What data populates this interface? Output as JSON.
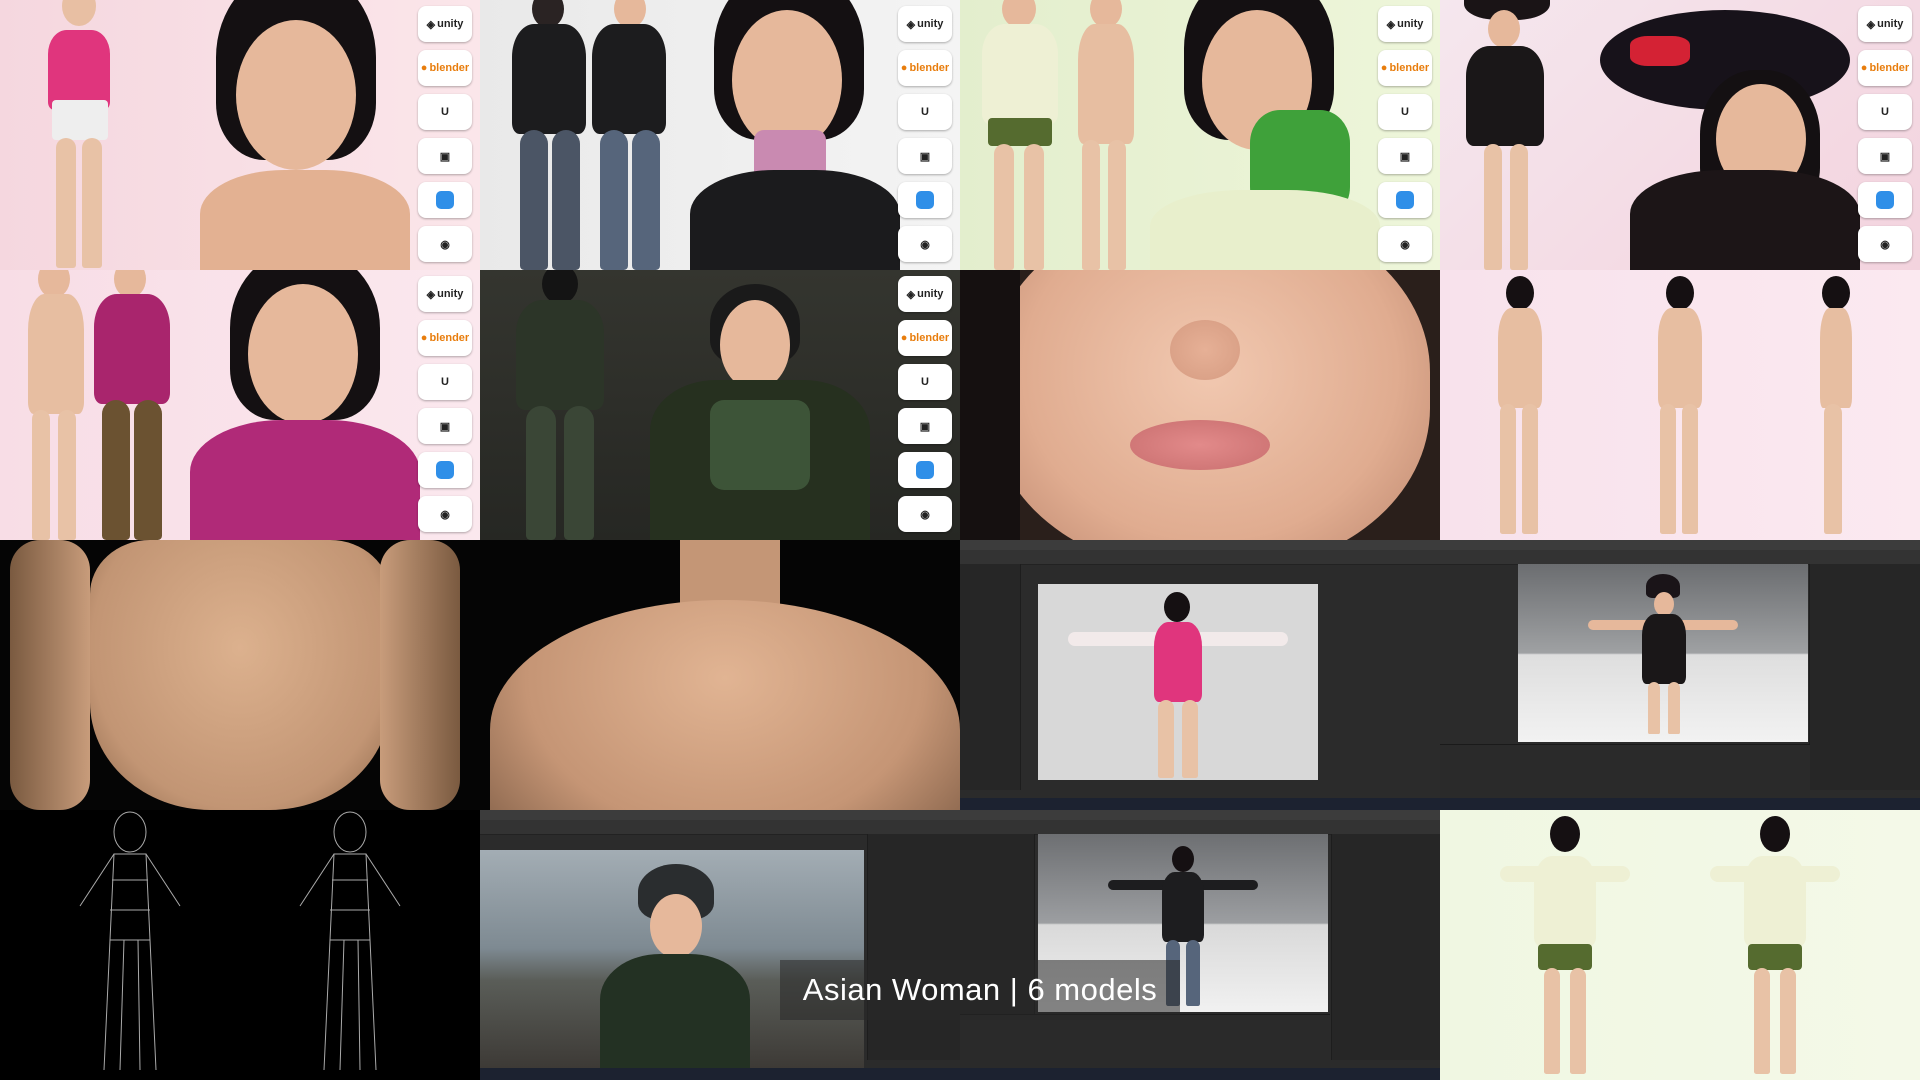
{
  "caption": {
    "title": "Asian Woman | 6 models"
  },
  "badges": {
    "unity": "unity",
    "blender": "blender"
  },
  "colors": {
    "skin": "#e8bfa3",
    "hair": "#141012",
    "pink_bg": "#f7d9e3",
    "green_bg": "#e6f2c8",
    "dark_bg": "#2e2f2b",
    "editor_bg": "#2b2b2b"
  },
  "icons": [
    "unity-icon",
    "blender-icon",
    "unreal-icon",
    "fbx-icon",
    "app-icon",
    "obj-icon"
  ]
}
